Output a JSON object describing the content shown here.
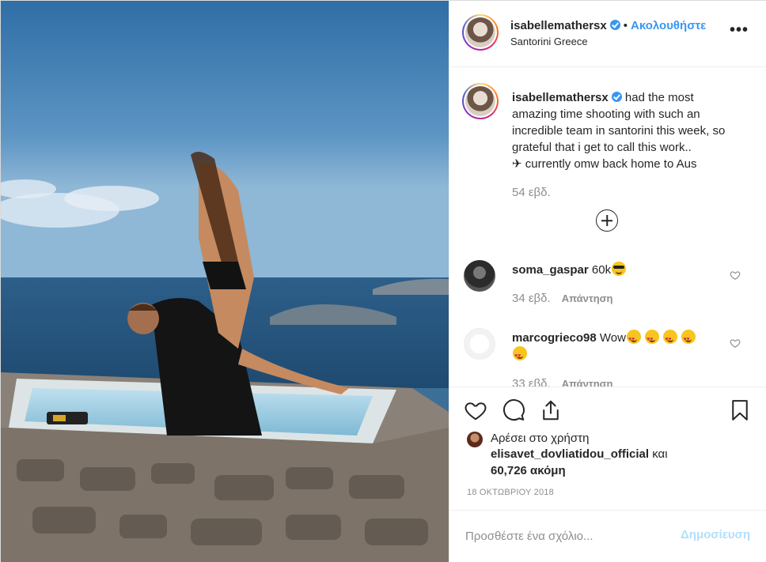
{
  "header": {
    "username": "isabellemathersx",
    "separator": "•",
    "follow_label": "Ακολουθήστε",
    "location": "Santorini Greece",
    "more_label": "•••"
  },
  "caption": {
    "username": "isabellemathersx",
    "text": "had the most amazing time shooting with such an incredible team in santorini this week, so grateful that i get to call this work..",
    "text2": "✈ currently omw back home to Aus",
    "time": "54 εβδ."
  },
  "comments": [
    {
      "username": "soma_gaspar",
      "text": "60k",
      "time": "34 εβδ.",
      "reply_label": "Απάντηση"
    },
    {
      "username": "marcogrieco98",
      "text": "Wow",
      "time": "33 εβδ.",
      "reply_label": "Απάντηση"
    }
  ],
  "likes": {
    "prefix": "Αρέσει στο χρήστη",
    "user": "elisavet_dovliatidou_official",
    "and": "και",
    "count": "60,726 ακόμη"
  },
  "date": "18 ΟΚΤΩΒΡΙΟΥ 2018",
  "add_comment": {
    "placeholder": "Προσθέστε ένα σχόλιο...",
    "post_label": "Δημοσίευση"
  },
  "icons": {
    "like": "heart-icon",
    "comment": "comment-bubble-icon",
    "share": "share-icon",
    "save": "bookmark-icon",
    "load_more": "plus-circle-icon",
    "verified": "verified-badge-icon"
  },
  "colors": {
    "accent": "#3897f0",
    "post_disabled": "#b2dffc",
    "muted": "#8e8e8e",
    "text": "#262626"
  }
}
